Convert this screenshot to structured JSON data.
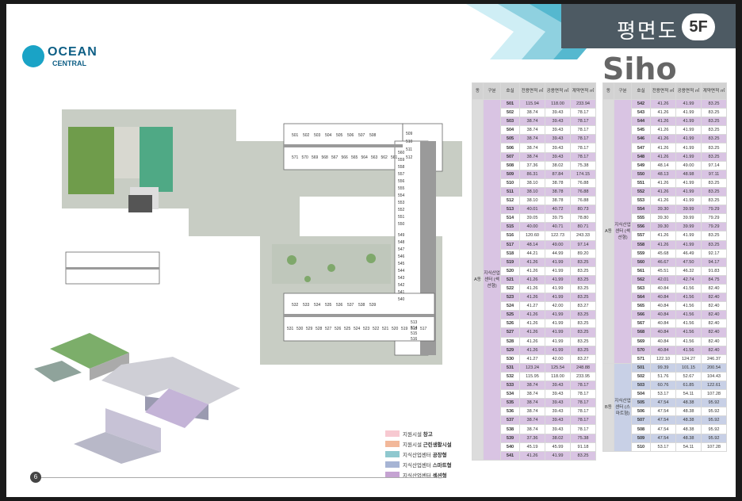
{
  "header": {
    "title": "평면도",
    "floor": "5F"
  },
  "watermark": "Siho",
  "logo": {
    "line1": "OCEAN",
    "line2": "CENTRAL"
  },
  "page_number": "6",
  "colors": {
    "header_dark": "#4d5a63",
    "band_light": "#8fd1e0",
    "warehouse": "#f7c9d1",
    "living": "#f2b89a",
    "factory": "#8fc8cf",
    "smart": "#a6b4d4",
    "section": "#c5a3d2"
  },
  "legend": [
    {
      "label_prefix": "지원시설",
      "label_bold": "창고",
      "color": "#f7c9d1"
    },
    {
      "label_prefix": "지원시설",
      "label_bold": "근린생활시설",
      "color": "#f2b89a"
    },
    {
      "label_prefix": "지식산업센터",
      "label_bold": "공장형",
      "color": "#8fc8cf"
    },
    {
      "label_prefix": "지식산업센터",
      "label_bold": "스마트형",
      "color": "#a6b4d4"
    },
    {
      "label_prefix": "지식산업센터",
      "label_bold": "섹션형",
      "color": "#c5a3d2"
    }
  ],
  "table_headers": [
    "동",
    "구분",
    "호실",
    "전용면적 ㎡",
    "공용면적 ㎡",
    "계약면적 ㎡"
  ],
  "tableA": {
    "dong": "A동",
    "type": "지식산업센터 (섹션형)",
    "rows": [
      [
        "501",
        "115.94",
        "118.00",
        "233.94"
      ],
      [
        "502",
        "38.74",
        "39.43",
        "78.17"
      ],
      [
        "503",
        "38.74",
        "39.43",
        "78.17"
      ],
      [
        "504",
        "38.74",
        "39.43",
        "78.17"
      ],
      [
        "505",
        "38.74",
        "39.43",
        "78.17"
      ],
      [
        "506",
        "38.74",
        "39.43",
        "78.17"
      ],
      [
        "507",
        "38.74",
        "39.43",
        "78.17"
      ],
      [
        "508",
        "37.36",
        "38.02",
        "75.38"
      ],
      [
        "509",
        "86.31",
        "87.84",
        "174.15"
      ],
      [
        "510",
        "38.10",
        "38.78",
        "76.88"
      ],
      [
        "511",
        "38.10",
        "38.78",
        "76.88"
      ],
      [
        "512",
        "38.10",
        "38.78",
        "76.88"
      ],
      [
        "513",
        "40.01",
        "40.72",
        "80.73"
      ],
      [
        "514",
        "39.05",
        "39.75",
        "78.80"
      ],
      [
        "515",
        "40.00",
        "40.71",
        "80.71"
      ],
      [
        "516",
        "120.60",
        "122.73",
        "243.33"
      ],
      [
        "517",
        "48.14",
        "49.00",
        "97.14"
      ],
      [
        "518",
        "44.21",
        "44.99",
        "89.20"
      ],
      [
        "519",
        "41.26",
        "41.99",
        "83.25"
      ],
      [
        "520",
        "41.26",
        "41.99",
        "83.25"
      ],
      [
        "521",
        "41.26",
        "41.99",
        "83.25"
      ],
      [
        "522",
        "41.26",
        "41.99",
        "83.25"
      ],
      [
        "523",
        "41.26",
        "41.99",
        "83.25"
      ],
      [
        "524",
        "41.27",
        "42.00",
        "83.27"
      ],
      [
        "525",
        "41.26",
        "41.99",
        "83.25"
      ],
      [
        "526",
        "41.26",
        "41.99",
        "83.25"
      ],
      [
        "527",
        "41.26",
        "41.99",
        "83.25"
      ],
      [
        "528",
        "41.26",
        "41.99",
        "83.25"
      ],
      [
        "529",
        "41.26",
        "41.99",
        "83.25"
      ],
      [
        "530",
        "41.27",
        "42.00",
        "83.27"
      ],
      [
        "531",
        "123.24",
        "125.54",
        "248.88"
      ],
      [
        "532",
        "115.95",
        "118.00",
        "233.95"
      ],
      [
        "533",
        "38.74",
        "39.43",
        "78.17"
      ],
      [
        "534",
        "38.74",
        "39.43",
        "78.17"
      ],
      [
        "535",
        "38.74",
        "39.43",
        "78.17"
      ],
      [
        "536",
        "38.74",
        "39.43",
        "78.17"
      ],
      [
        "537",
        "38.74",
        "39.43",
        "78.17"
      ],
      [
        "538",
        "38.74",
        "39.43",
        "78.17"
      ],
      [
        "539",
        "37.36",
        "38.02",
        "75.38"
      ],
      [
        "540",
        "45.19",
        "45.99",
        "91.18"
      ],
      [
        "541",
        "41.26",
        "41.99",
        "83.25"
      ]
    ]
  },
  "tableB_A": {
    "dong": "A동",
    "type": "지식산업센터 (섹션형)",
    "rows": [
      [
        "542",
        "41.26",
        "41.99",
        "83.25"
      ],
      [
        "543",
        "41.26",
        "41.99",
        "83.25"
      ],
      [
        "544",
        "41.26",
        "41.99",
        "83.25"
      ],
      [
        "545",
        "41.26",
        "41.99",
        "83.25"
      ],
      [
        "546",
        "41.26",
        "41.99",
        "83.25"
      ],
      [
        "547",
        "41.26",
        "41.99",
        "83.25"
      ],
      [
        "548",
        "41.26",
        "41.99",
        "83.25"
      ],
      [
        "549",
        "48.14",
        "49.00",
        "97.14"
      ],
      [
        "550",
        "48.13",
        "48.98",
        "97.11"
      ],
      [
        "551",
        "41.26",
        "41.99",
        "83.25"
      ],
      [
        "552",
        "41.26",
        "41.99",
        "83.25"
      ],
      [
        "553",
        "41.26",
        "41.99",
        "83.25"
      ],
      [
        "554",
        "39.30",
        "39.99",
        "79.29"
      ],
      [
        "555",
        "39.30",
        "39.99",
        "79.29"
      ],
      [
        "556",
        "39.30",
        "39.99",
        "79.29"
      ],
      [
        "557",
        "41.26",
        "41.99",
        "83.25"
      ],
      [
        "558",
        "41.26",
        "41.99",
        "83.25"
      ],
      [
        "559",
        "45.68",
        "46.49",
        "92.17"
      ],
      [
        "560",
        "46.67",
        "47.50",
        "94.17"
      ],
      [
        "561",
        "45.51",
        "46.32",
        "91.83"
      ],
      [
        "562",
        "42.01",
        "42.74",
        "84.75"
      ],
      [
        "563",
        "40.84",
        "41.56",
        "82.40"
      ],
      [
        "564",
        "40.84",
        "41.56",
        "82.40"
      ],
      [
        "565",
        "40.84",
        "41.56",
        "82.40"
      ],
      [
        "566",
        "40.84",
        "41.56",
        "82.40"
      ],
      [
        "567",
        "40.84",
        "41.56",
        "82.40"
      ],
      [
        "568",
        "40.84",
        "41.56",
        "82.40"
      ],
      [
        "569",
        "40.84",
        "41.56",
        "82.40"
      ],
      [
        "570",
        "40.84",
        "41.56",
        "82.40"
      ],
      [
        "571",
        "122.10",
        "124.27",
        "246.37"
      ]
    ]
  },
  "tableB_B": {
    "dong": "B동",
    "type": "지식산업센터 (스마트형)",
    "rows": [
      [
        "501",
        "99.39",
        "101.15",
        "200.54"
      ],
      [
        "502",
        "51.76",
        "52.67",
        "104.43"
      ],
      [
        "503",
        "60.76",
        "61.85",
        "122.61"
      ],
      [
        "504",
        "53.17",
        "54.11",
        "107.28"
      ],
      [
        "505",
        "47.54",
        "48.38",
        "95.92"
      ],
      [
        "506",
        "47.54",
        "48.38",
        "95.92"
      ],
      [
        "507",
        "47.54",
        "48.38",
        "95.92"
      ],
      [
        "508",
        "47.54",
        "48.38",
        "95.92"
      ],
      [
        "509",
        "47.54",
        "48.38",
        "95.92"
      ],
      [
        "510",
        "53.17",
        "54.11",
        "107.28"
      ]
    ]
  },
  "plan_labels": {
    "top_a": [
      "501",
      "502",
      "503",
      "504",
      "505",
      "506",
      "507",
      "508"
    ],
    "top_b": [
      "571",
      "570",
      "569",
      "568",
      "567",
      "566",
      "565",
      "564",
      "563",
      "562",
      "561"
    ],
    "right_top": [
      "509",
      "510",
      "511",
      "512"
    ],
    "right_col": [
      "560",
      "559",
      "558",
      "557",
      "556",
      "555",
      "554",
      "553",
      "552",
      "551",
      "550"
    ],
    "mid_col": [
      "549",
      "548",
      "547",
      "546",
      "545",
      "544",
      "543",
      "542",
      "541",
      "540"
    ],
    "bot_a": [
      "532",
      "533",
      "534",
      "535",
      "536",
      "537",
      "538",
      "539"
    ],
    "bot_b": [
      "531",
      "530",
      "529",
      "528",
      "527",
      "526",
      "525",
      "524",
      "523",
      "522",
      "521",
      "520",
      "519",
      "518",
      "517"
    ],
    "bot_right": [
      "513",
      "514",
      "515",
      "516"
    ],
    "b_top": [
      "501",
      "502",
      "503"
    ],
    "b_bot": [
      "510",
      "509",
      "508",
      "507",
      "506",
      "505",
      "504"
    ]
  }
}
